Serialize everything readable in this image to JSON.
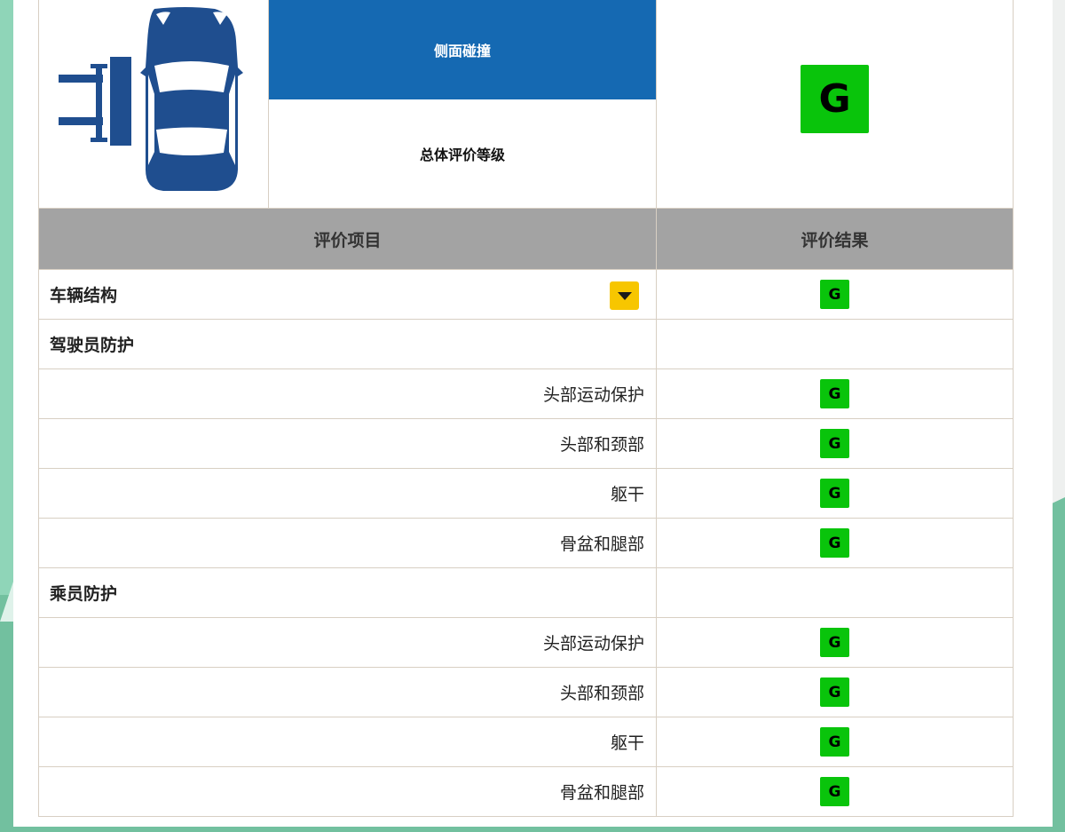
{
  "test": {
    "name": "侧面碰撞",
    "overall_label": "总体评价等级",
    "overall_rating": "G"
  },
  "table": {
    "header_item": "评价项目",
    "header_result": "评价结果",
    "rows": [
      {
        "label": "车辆结构",
        "rating": "G",
        "type": "category"
      },
      {
        "label": "驾驶员防护",
        "rating": "",
        "type": "category"
      },
      {
        "label": "头部运动保护",
        "rating": "G",
        "type": "sub"
      },
      {
        "label": "头部和颈部",
        "rating": "G",
        "type": "sub"
      },
      {
        "label": "躯干",
        "rating": "G",
        "type": "sub"
      },
      {
        "label": "骨盆和腿部",
        "rating": "G",
        "type": "sub"
      },
      {
        "label": "乘员防护",
        "rating": "",
        "type": "category"
      },
      {
        "label": "头部运动保护",
        "rating": "G",
        "type": "sub"
      },
      {
        "label": "头部和颈部",
        "rating": "G",
        "type": "sub"
      },
      {
        "label": "躯干",
        "rating": "G",
        "type": "sub"
      },
      {
        "label": "骨盆和腿部",
        "rating": "G",
        "type": "sub"
      }
    ]
  },
  "colors": {
    "test_header_bg": "#1569b2",
    "rating_good": "#09c40b",
    "dropdown": "#f7c600",
    "table_header_bg": "#a3a3a3"
  },
  "icons": {
    "car": "car-side-impact-icon",
    "dropdown": "chevron-down-icon"
  }
}
